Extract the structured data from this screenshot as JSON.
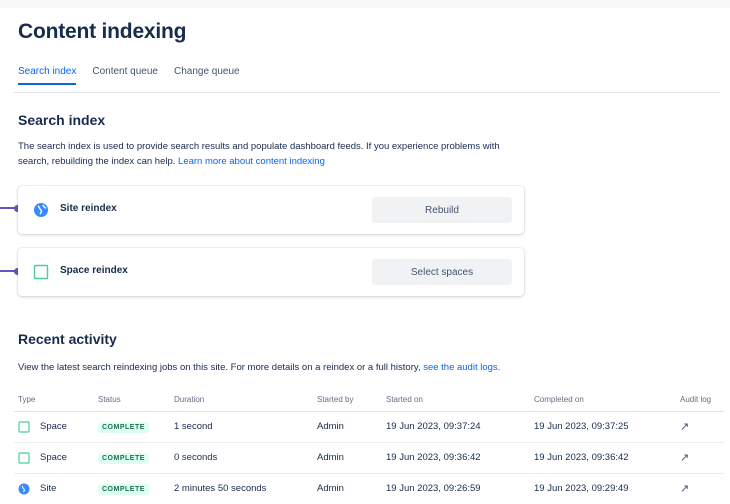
{
  "page_title": "Content indexing",
  "tabs": [
    {
      "label": "Search index"
    },
    {
      "label": "Content queue"
    },
    {
      "label": "Change queue"
    }
  ],
  "search_index": {
    "heading": "Search index",
    "description": "The search index is used to provide search results and populate dashboard feeds. If you experience problems with search, rebuilding the index can help.",
    "learn_more_link": "Learn more about content indexing",
    "site_reindex": {
      "label": "Site reindex",
      "button": "Rebuild",
      "icon": "globe-icon"
    },
    "space_reindex": {
      "label": "Space reindex",
      "button": "Select spaces",
      "icon": "space-icon"
    }
  },
  "recent_activity": {
    "heading": "Recent activity",
    "description": "View the latest search reindexing jobs on this site. For more details on a reindex or a full history,",
    "audit_link": "see the audit logs.",
    "columns": [
      "Type",
      "Status",
      "Duration",
      "Started by",
      "Started on",
      "Completed on",
      "Audit log"
    ],
    "rows": [
      {
        "type": "Space",
        "icon": "space-icon",
        "status": "COMPLETE",
        "duration": "1 second",
        "started_by": "Admin",
        "started_on": "19 Jun 2023, 09:37:24",
        "completed_on": "19 Jun 2023, 09:37:25",
        "audit": "↗"
      },
      {
        "type": "Space",
        "icon": "space-icon",
        "status": "COMPLETE",
        "duration": "0 seconds",
        "started_by": "Admin",
        "started_on": "19 Jun 2023, 09:36:42",
        "completed_on": "19 Jun 2023, 09:36:42",
        "audit": "↗"
      },
      {
        "type": "Site",
        "icon": "globe-icon",
        "status": "COMPLETE",
        "duration": "2 minutes 50 seconds",
        "started_by": "Admin",
        "started_on": "19 Jun 2023, 09:26:59",
        "completed_on": "19 Jun 2023, 09:29:49",
        "audit": "↗"
      }
    ]
  },
  "colors": {
    "accent": "#0c66e4",
    "connector": "#6554c0",
    "complete_bg": "#dcfff1",
    "complete_text": "#216e4e"
  }
}
